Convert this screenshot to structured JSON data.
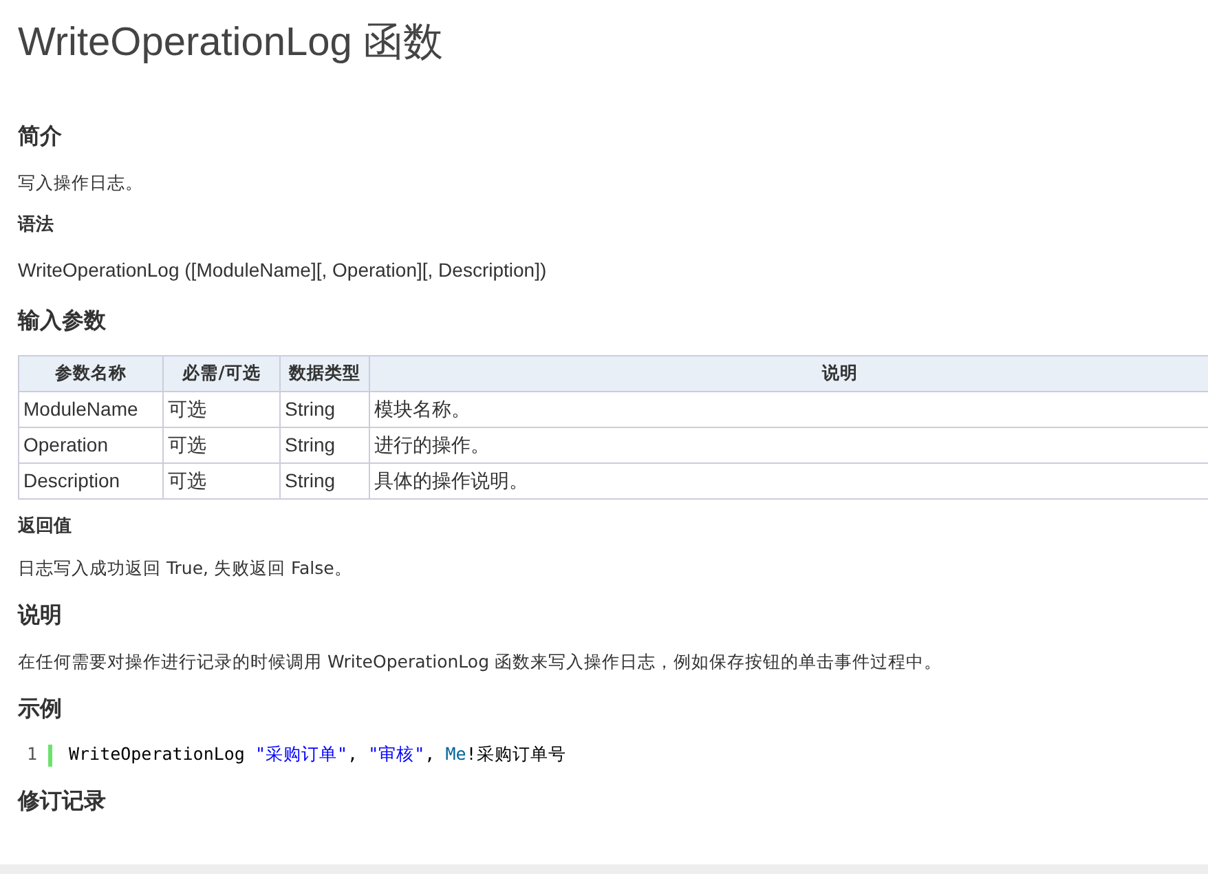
{
  "title": "WriteOperationLog 函数",
  "sections": [
    {
      "kind": "heading",
      "text": "简介"
    },
    {
      "kind": "paragraph",
      "text": "写入操作日志。"
    },
    {
      "kind": "subheading",
      "text": "语法"
    },
    {
      "kind": "syntax",
      "text": "WriteOperationLog ([ModuleName][, Operation][, Description])"
    },
    {
      "kind": "heading",
      "text": "输入参数"
    },
    {
      "kind": "table",
      "columns": [
        "参数名称",
        "必需/可选",
        "数据类型",
        "说明"
      ],
      "rows": [
        [
          "ModuleName",
          "可选",
          "String",
          "模块名称。"
        ],
        [
          "Operation",
          "可选",
          "String",
          "进行的操作。"
        ],
        [
          "Description",
          "可选",
          "String",
          "具体的操作说明。"
        ]
      ]
    },
    {
      "kind": "subheading",
      "text": "返回值"
    },
    {
      "kind": "paragraph",
      "text": "日志写入成功返回 True, 失败返回 False。"
    },
    {
      "kind": "heading",
      "text": "说明"
    },
    {
      "kind": "paragraph",
      "text": "在任何需要对操作进行记录的时候调用 WriteOperationLog 函数来写入操作日志，例如保存按钮的单击事件过程中。"
    },
    {
      "kind": "heading",
      "text": "示例"
    },
    {
      "kind": "code",
      "lines": [
        {
          "number": "1",
          "tokens": [
            {
              "kind": "plain",
              "text": "WriteOperationLog "
            },
            {
              "kind": "string",
              "text": "\"采购订单\""
            },
            {
              "kind": "plain",
              "text": ", "
            },
            {
              "kind": "string",
              "text": "\"审核\""
            },
            {
              "kind": "plain",
              "text": ", "
            },
            {
              "kind": "keyword",
              "text": "Me"
            },
            {
              "kind": "plain",
              "text": "!采购订单号"
            }
          ]
        }
      ]
    },
    {
      "kind": "heading",
      "text": "修订记录"
    }
  ]
}
